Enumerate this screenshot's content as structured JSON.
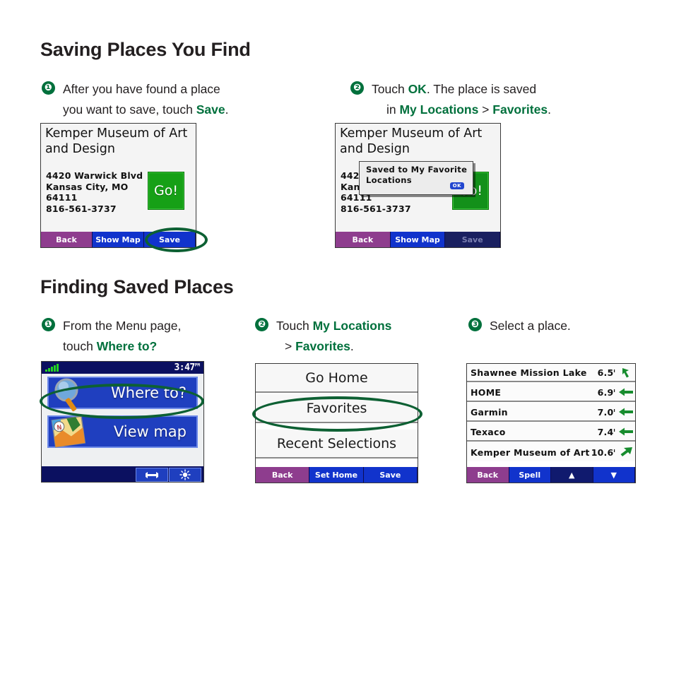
{
  "sections": [
    {
      "title": "Saving Places You Find",
      "steps": [
        {
          "num": "❶",
          "line1_pre": "After you have found a place",
          "line2_pre": "you want to save, touch ",
          "line2_bold": "Save",
          "line2_post": "."
        },
        {
          "num": "❷",
          "line1_pre": "Touch ",
          "line1_bold": "OK",
          "line1_post": ". The place is saved",
          "line2_pre": "in ",
          "line2_bold": "My Locations",
          "line2_mid": " > ",
          "line2_bold2": "Favorites",
          "line2_post": "."
        }
      ]
    },
    {
      "title": "Finding Saved Places",
      "steps": [
        {
          "num": "❶",
          "line1_pre": "From the Menu page,",
          "line2_pre": "touch ",
          "line2_bold": "Where to?"
        },
        {
          "num": "❷",
          "line1_pre": "Touch ",
          "line1_bold": "My Locations",
          "line2_pre": "> ",
          "line2_bold": "Favorites",
          "line2_post": "."
        },
        {
          "num": "❸",
          "line1_pre": "Select a place."
        }
      ]
    }
  ],
  "screens": {
    "poi": {
      "title": "Kemper Museum of Art and Design",
      "address_lines": [
        "4420 Warwick Blvd",
        "Kansas City, MO",
        "64111",
        "816-561-3737"
      ],
      "go_label": "Go!",
      "softkeys": [
        "Back",
        "Show Map",
        "Save"
      ]
    },
    "poi_saved": {
      "title": "Kemper Museum of Art and Design",
      "address_lines": [
        "4420",
        "Kans",
        "64111",
        "816-561-3737"
      ],
      "go_label": "Go!",
      "popup_line1": "Saved to My Favorite",
      "popup_line2": "Locations",
      "popup_ok": "OK",
      "softkeys": [
        "Back",
        "Show Map",
        "Save"
      ]
    },
    "menu": {
      "clock": "3:47",
      "clock_suffix": "PM",
      "buttons": [
        {
          "label": "Where to?",
          "icon": "magnifier-icon"
        },
        {
          "label": "View map",
          "icon": "map-icon"
        }
      ],
      "tools": [
        {
          "icon": "wrench-icon"
        },
        {
          "icon": "brightness-icon"
        }
      ]
    },
    "my_locations": {
      "rows": [
        "Go Home",
        "Favorites",
        "Recent Selections"
      ],
      "softkeys": [
        "Back",
        "Set Home",
        "Save"
      ]
    },
    "favorites": {
      "rows": [
        {
          "name": "Shawnee Mission Lake",
          "distance": "6.5",
          "unit": "ı",
          "direction": "up-left"
        },
        {
          "name": "HOME",
          "distance": "6.9",
          "unit": "ı",
          "direction": "left"
        },
        {
          "name": "Garmin",
          "distance": "7.0",
          "unit": "ı",
          "direction": "left"
        },
        {
          "name": "Texaco",
          "distance": "7.4",
          "unit": "ı",
          "direction": "left"
        },
        {
          "name": "Kemper Museum of Art",
          "distance": "10.6",
          "unit": "ı",
          "direction": "up-right"
        }
      ],
      "softkeys": [
        "Back",
        "Spell"
      ],
      "scroll_up": "▲",
      "scroll_down": "▼"
    }
  },
  "colors": {
    "accent_green": "#00703c",
    "highlight_ellipse": "#0d6033",
    "button_blue": "#1f3fbf",
    "back_purple": "#8e3d8e",
    "go_green": "#16a016"
  }
}
